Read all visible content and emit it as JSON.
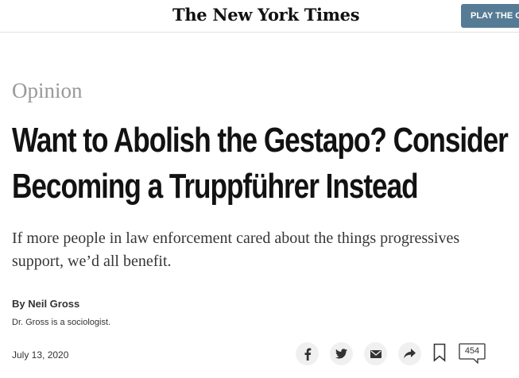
{
  "header": {
    "logo_text": "The New York Times",
    "play_button_label": "PLAY THE CROSSWORD"
  },
  "article": {
    "section": "Opinion",
    "headline_line1": "Want to Abolish the Gestapo? Consider",
    "headline_line2": "Becoming a Truppführer Instead",
    "summary": "If more people in law enforcement cared about the things progressives support, we’d all benefit.",
    "byline": "By Neil Gross",
    "author_bio": "Dr. Gross is a sociologist.",
    "date": "July 13, 2020"
  },
  "share_tools": {
    "icons": [
      "facebook-icon",
      "twitter-icon",
      "email-icon",
      "share-icon",
      "bookmark-icon",
      "comments-icon"
    ],
    "comment_count": "454"
  }
}
